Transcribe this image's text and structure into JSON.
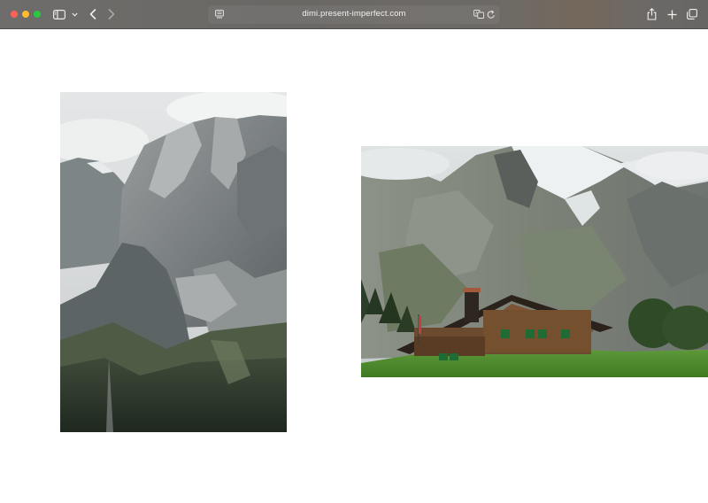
{
  "browser": {
    "address_bar": {
      "url": "dimi.present-imperfect.com"
    },
    "icons": {
      "sidebar": "sidebar-icon",
      "sidebar_menu": "chevron-down-icon",
      "back": "chevron-left-icon",
      "forward": "chevron-right-icon",
      "page": "page-settings-icon",
      "translate": "translate-icon",
      "reload": "reload-icon",
      "share": "share-icon",
      "new_tab": "plus-icon",
      "tab_overview": "tab-overview-icon"
    },
    "colors": {
      "close": "#ff5f57",
      "minimize": "#febc2e",
      "maximize": "#28c840"
    }
  },
  "page": {
    "background": "#ffffff",
    "photos": [
      {
        "subject": "mountain-peaks"
      },
      {
        "subject": "alpine-wooden-chalet"
      }
    ]
  }
}
